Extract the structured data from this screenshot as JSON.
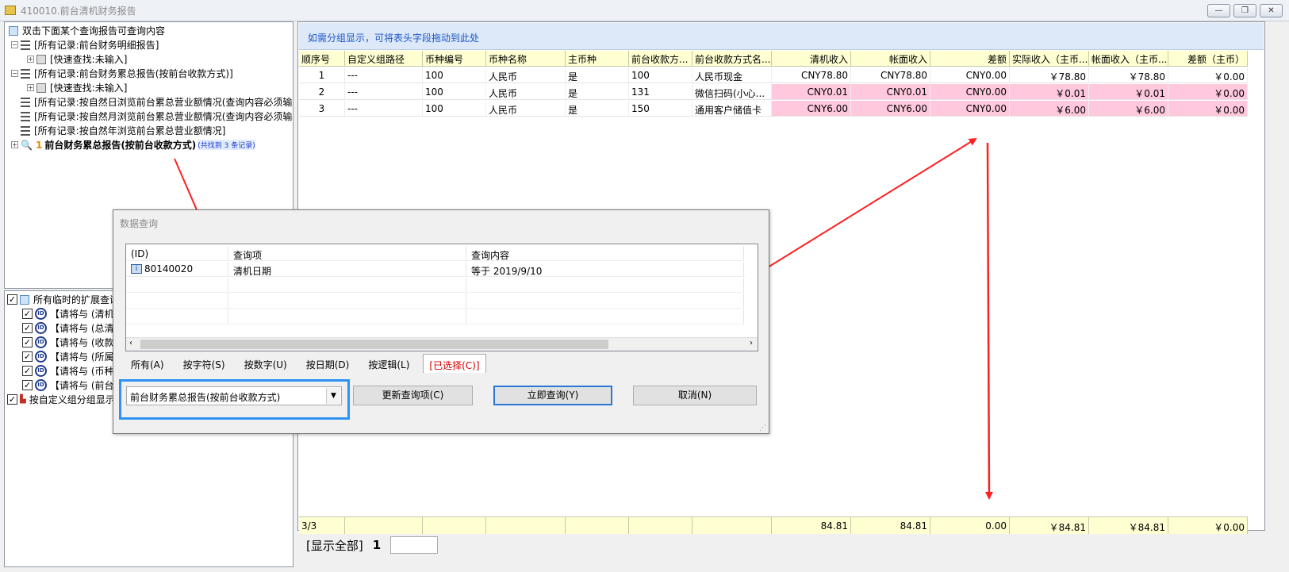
{
  "window": {
    "title": "410010.前台清机财务报告"
  },
  "left_tree": {
    "hint": "双击下面某个查询报告可查询内容",
    "items": [
      {
        "label": "[所有记录:前台财务明细报告]"
      },
      {
        "label": "[快速查找:未输入]"
      },
      {
        "label": "[所有记录:前台财务累总报告(按前台收款方式)]"
      },
      {
        "label": "[快速查找:未输入]"
      },
      {
        "label": "[所有记录:按自然日浏览前台累总营业额情况(查询内容必须输"
      },
      {
        "label": "[所有记录:按自然月浏览前台累总营业额情况(查询内容必须输"
      },
      {
        "label": "[所有记录:按自然年浏览前台累总营业额情况]"
      }
    ],
    "active_item": {
      "number": "1",
      "label": "前台财务累总报告(按前台收款方式)",
      "count": "(共找到 3 条记录)"
    }
  },
  "left_bottom": {
    "root_label": "所有临时的扩展查询",
    "items": [
      {
        "label": "【请将与 (清机"
      },
      {
        "label": "【请将与 (总清"
      },
      {
        "label": "【请将与 (收款"
      },
      {
        "label": "【请将与 (所属"
      },
      {
        "label": "【请将与 (币种"
      },
      {
        "label": "【请将与 (前台"
      }
    ],
    "group_label": "按自定义组分组显示"
  },
  "grid": {
    "group_hint": "如需分组显示，可将表头字段拖动到此处",
    "columns": [
      "顺序号",
      "自定义组路径",
      "币种编号",
      "币种名称",
      "主币种",
      "前台收款方...",
      "前台收款方式名...",
      "清机收入",
      "帐面收入",
      "差额",
      "实际收入（主币...",
      "帐面收入（主币...",
      "差额（主币）"
    ],
    "rows": [
      [
        "1",
        "---",
        "100",
        "人民币",
        "是",
        "100",
        "人民币现金",
        "CNY78.80",
        "CNY78.80",
        "CNY0.00",
        "￥78.80",
        "￥78.80",
        "￥0.00"
      ],
      [
        "2",
        "---",
        "100",
        "人民币",
        "是",
        "131",
        "微信扫码(小心...",
        "CNY0.01",
        "CNY0.01",
        "CNY0.00",
        "￥0.01",
        "￥0.01",
        "￥0.00"
      ],
      [
        "3",
        "---",
        "100",
        "人民币",
        "是",
        "150",
        "通用客户储值卡",
        "CNY6.00",
        "CNY6.00",
        "CNY0.00",
        "￥6.00",
        "￥6.00",
        "￥0.00"
      ]
    ],
    "footer": [
      "3/3",
      "",
      "",
      "",
      "",
      "",
      "",
      "84.81",
      "84.81",
      "0.00",
      "￥84.81",
      "￥84.81",
      "￥0.00"
    ]
  },
  "pager": {
    "show_all": "[显示全部]",
    "page": "1",
    "input_value": ""
  },
  "dialog": {
    "title": "数据查询",
    "columns": [
      "(ID)",
      "查询项",
      "查询内容"
    ],
    "rows": [
      [
        "80140020",
        "清机日期",
        "等于 2019/9/10"
      ]
    ],
    "tabs": [
      "所有(A)",
      "按字符(S)",
      "按数字(U)",
      "按日期(D)",
      "按逻辑(L)",
      "[已选择(C)]"
    ],
    "combo_value": "前台财务累总报告(按前台收款方式)",
    "buttons": {
      "update": "更新查询项(C)",
      "query": "立即查询(Y)",
      "cancel": "取消(N)"
    }
  },
  "colors": {
    "accent": "#2e93f0",
    "highlight": "#ffc8dc",
    "arrow": "#ff2020"
  }
}
